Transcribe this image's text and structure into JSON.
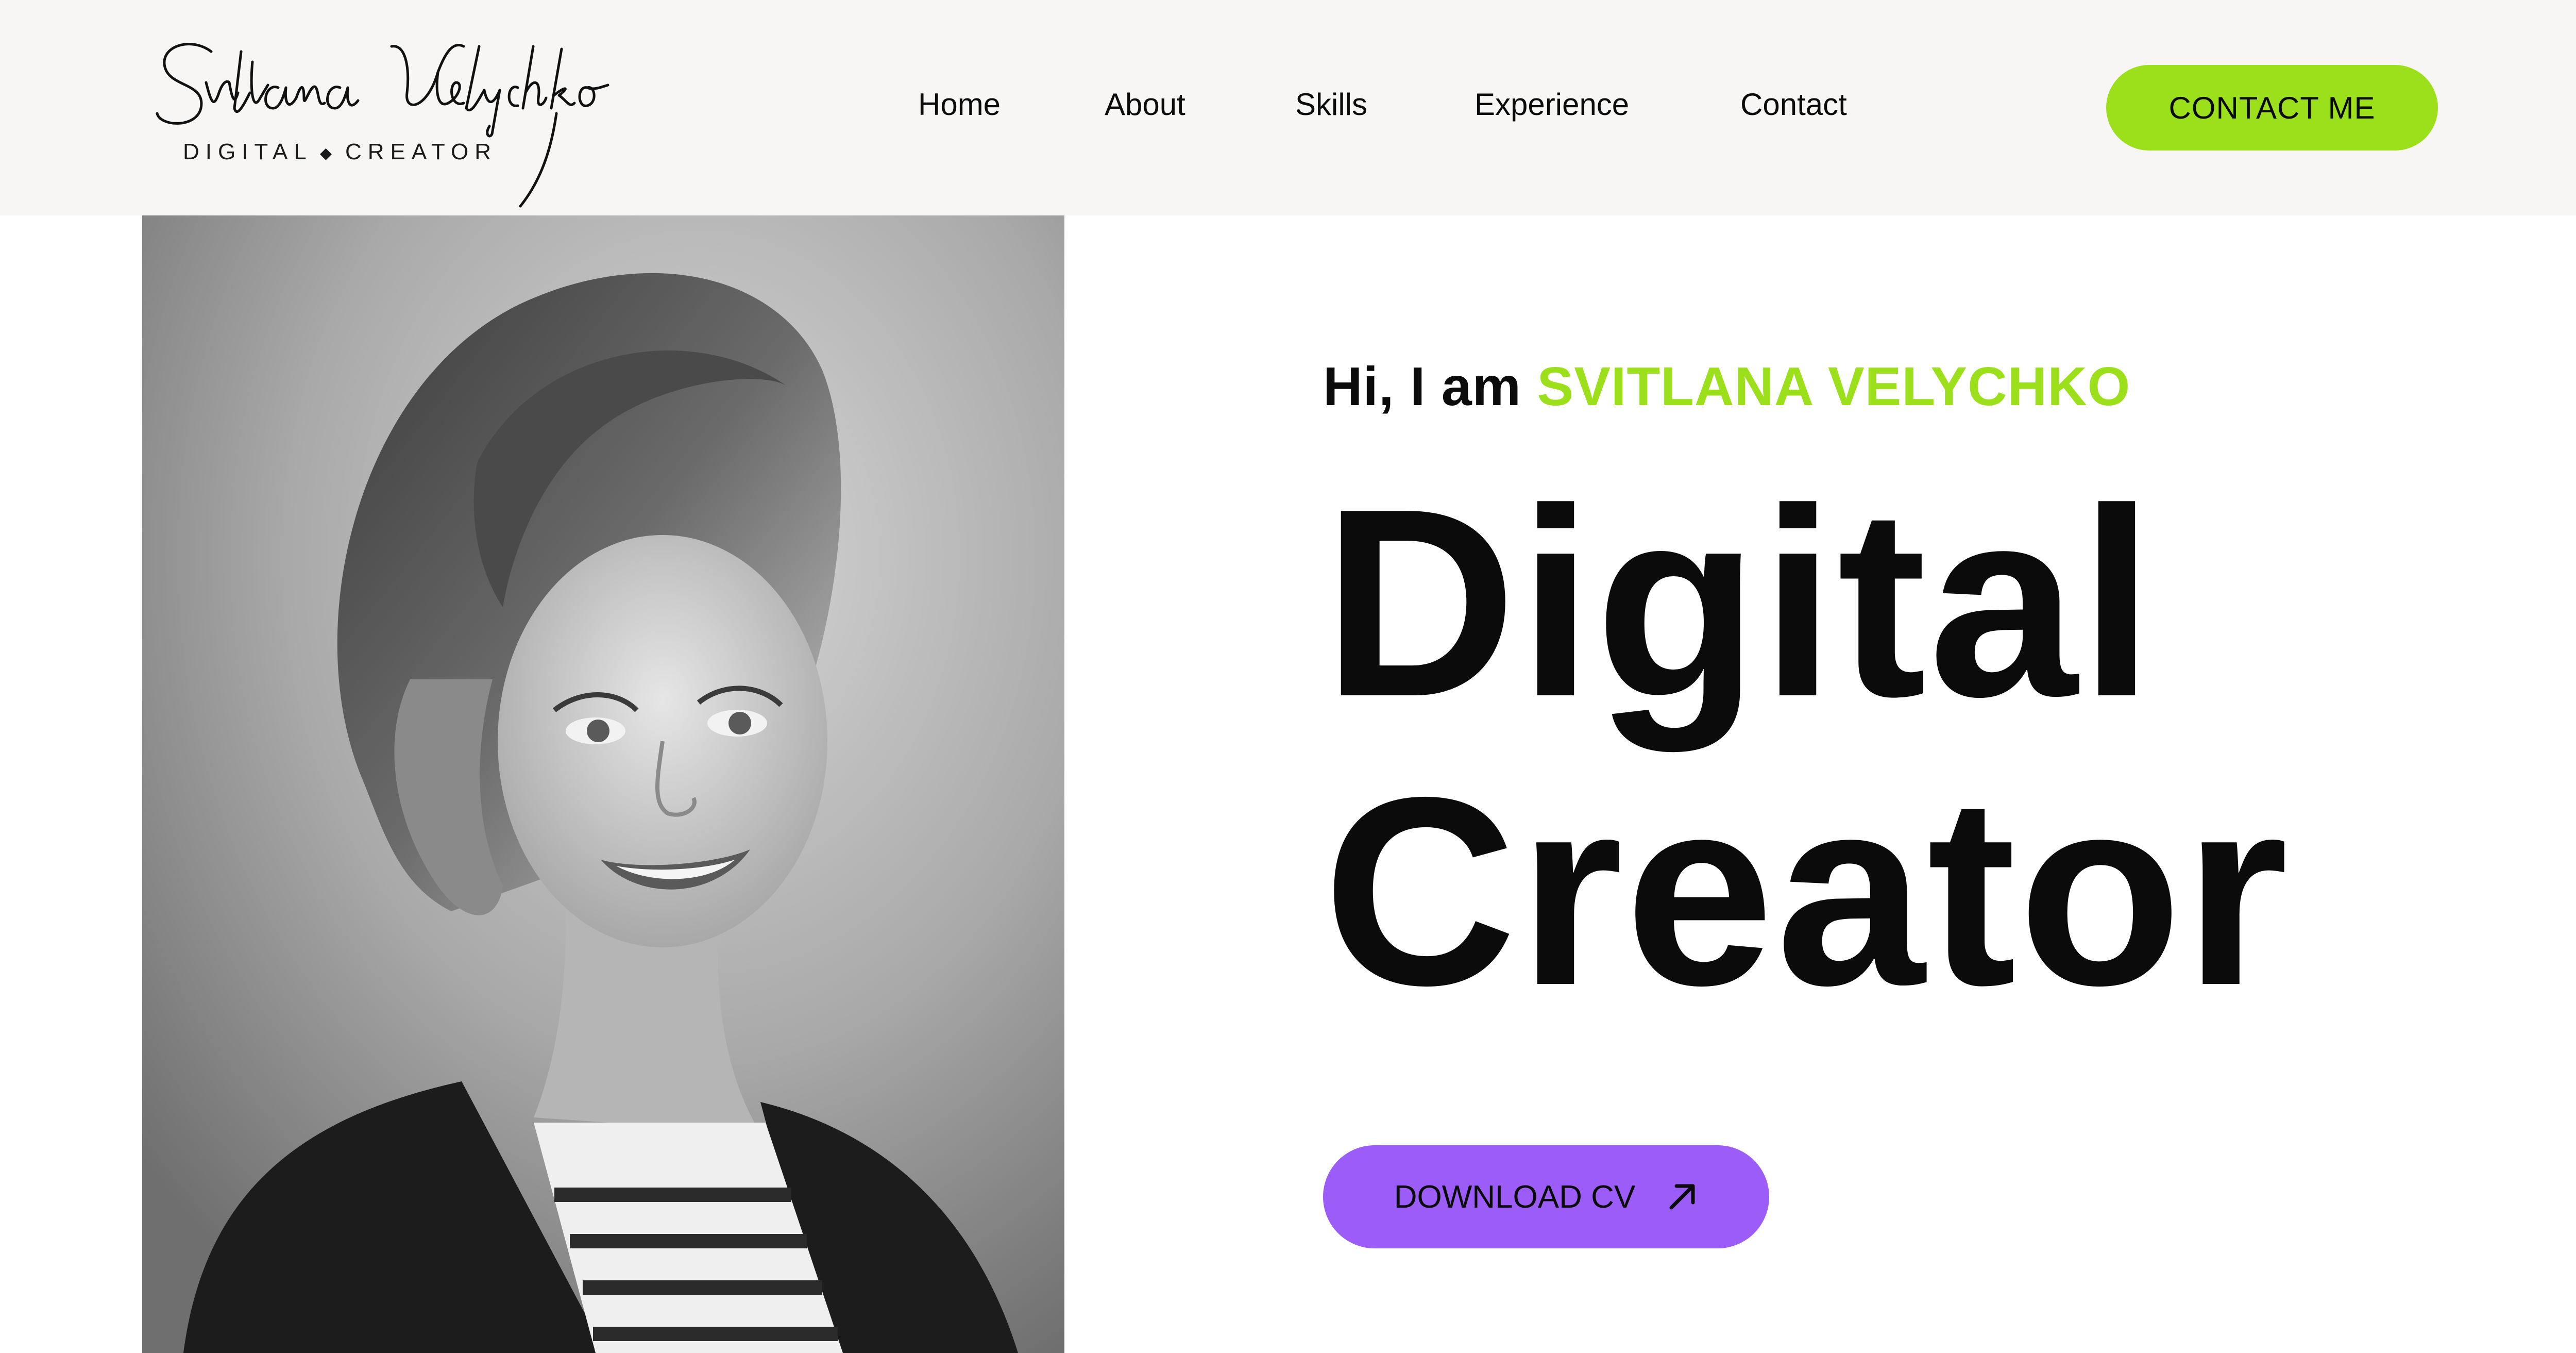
{
  "brand": {
    "signature": "Svitlana Velychko",
    "tagline_left": "DIGITAL",
    "tagline_right": "CREATOR"
  },
  "nav": {
    "items": [
      "Home",
      "About",
      "Skills",
      "Experience",
      "Contact"
    ]
  },
  "header": {
    "cta_label": "CONTACT ME"
  },
  "hero": {
    "greeting_prefix": "Hi, I am",
    "greeting_name": "SVITLANA VELYCHKO",
    "headline_line1": "Digital",
    "headline_line2": "Creator",
    "cv_button_label": "DOWNLOAD CV",
    "cv_icon": "arrow-up-right-icon",
    "photo": "black-and-white portrait photo"
  },
  "colors": {
    "accent_green": "#9be01a",
    "accent_purple": "#9b5cf7",
    "header_bg": "#f7f6f4",
    "text": "#0b0b0b"
  }
}
